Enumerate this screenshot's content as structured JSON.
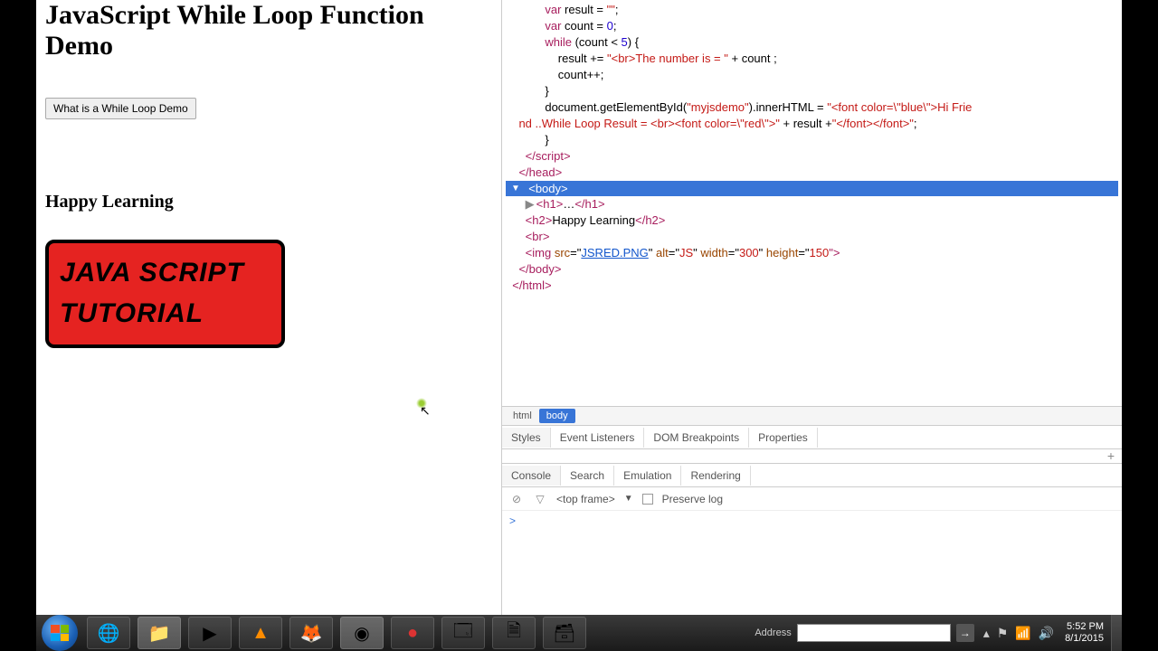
{
  "page": {
    "title": "JavaScript While Loop Function Demo",
    "button_label": "What is a While Loop Demo",
    "happy": "Happy Learning",
    "img_line1": "JAVA SCRIPT",
    "img_line2": "TUTORIAL"
  },
  "code": {
    "l1a": "            var",
    "l1b": " result = ",
    "l1c": "\"\"",
    "l1d": ";",
    "l2a": "            var",
    "l2b": " count = ",
    "l2c": "0",
    "l2d": ";",
    "l3a": "            while",
    "l3b": " (count < ",
    "l3c": "5",
    "l3d": ") {",
    "l4a": "                result += ",
    "l4b": "\"<br>The number is = \"",
    "l4c": " + count ;",
    "l5": "                count++;",
    "l6": "            }",
    "l7a": "            document.getElementById(",
    "l7b": "\"myjsdemo\"",
    "l7c": ").innerHTML = ",
    "l7d": "\"<font color=\\\"blue\\\">Hi Frie",
    "l8a": "    nd ..While Loop Result = <br><font color=\\\"red\\\">\"",
    "l8b": " + result +",
    "l8c": "\"</font></font>\"",
    "l8d": ";",
    "l9": "            }",
    "l10a": "      </script",
    "l10b": ">",
    "l11a": "    </head",
    "l11b": ">",
    "body_sel": "  <body>",
    "l13a": "      ",
    "l13tri": "▶ ",
    "l13b": "<h1>",
    "l13c": "…",
    "l13d": "</h1>",
    "l14a": "      <h2>",
    "l14b": "Happy Learning",
    "l14c": "</h2>",
    "l15": "      <br>",
    "l16a": "      <img ",
    "l16b": "src",
    "l16c": "=\"",
    "l16d": "JSRED.PNG",
    "l16e": "\" ",
    "l16f": "alt",
    "l16g": "=\"",
    "l16h": "JS",
    "l16i": "\" ",
    "l16j": "width",
    "l16k": "=\"",
    "l16l": "300",
    "l16m": "\" ",
    "l16n": "height",
    "l16o": "=\"",
    "l16p": "150",
    "l16q": "\">",
    "l17a": "    </body",
    "l17b": ">",
    "l18a": "  </html",
    "l18b": ">"
  },
  "breadcrumb": {
    "html": "html",
    "body": "body"
  },
  "devtabs": {
    "styles": "Styles",
    "event": "Event Listeners",
    "dom": "DOM Breakpoints",
    "props": "Properties"
  },
  "console_tabs": {
    "console": "Console",
    "search": "Search",
    "emulation": "Emulation",
    "rendering": "Rendering"
  },
  "console": {
    "frame": "<top frame>",
    "preserve": "Preserve log",
    "prompt": ">"
  },
  "taskbar": {
    "address_label": "Address",
    "time": "5:52 PM",
    "date": "8/1/2015"
  }
}
